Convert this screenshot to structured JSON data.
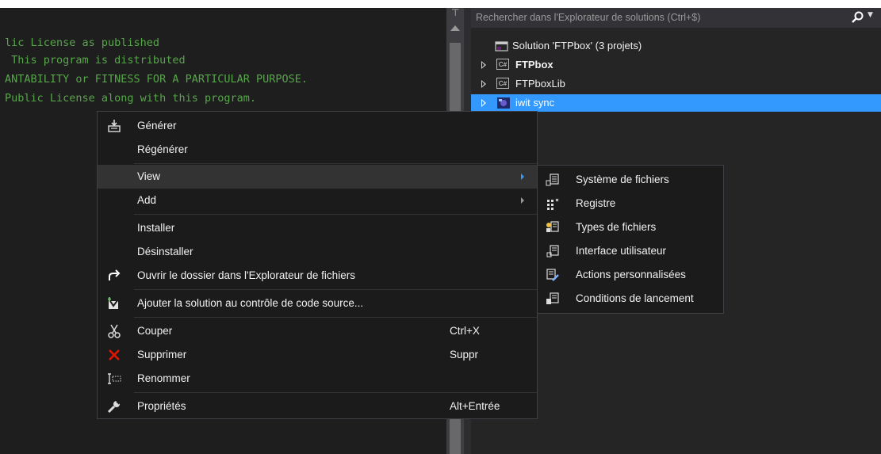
{
  "editor": {
    "lines": [
      "lic License as published",
      " This program is distributed",
      "ANTABILITY or FITNESS FOR A PARTICULAR PURPOSE.",
      "Public License along with this program."
    ]
  },
  "solution_explorer": {
    "search_placeholder": "Rechercher dans l'Explorateur de solutions (Ctrl+$)",
    "solution_label": "Solution 'FTPbox' (3 projets)",
    "projects": [
      {
        "label": "FTPbox",
        "icon": "csharp-project-icon",
        "bold": true
      },
      {
        "label": "FTPboxLib",
        "icon": "csharp-project-icon",
        "bold": false
      },
      {
        "label": "iwit sync",
        "icon": "setup-project-icon",
        "bold": false,
        "selected": true
      }
    ],
    "cs_badge": "C#"
  },
  "context_menu": {
    "items": [
      {
        "label": "Générer",
        "icon": "build-icon"
      },
      {
        "label": "Régénérer"
      },
      {
        "label": "View",
        "submenu": true,
        "hover": true
      },
      {
        "label": "Add",
        "submenu": true
      },
      {
        "label": "Installer"
      },
      {
        "label": "Désinstaller"
      },
      {
        "label": "Ouvrir le dossier dans l'Explorateur de fichiers",
        "icon": "open-folder-arrow-icon"
      },
      {
        "label": "Ajouter la solution au contrôle de code source...",
        "icon": "add-source-control-icon"
      },
      {
        "label": "Couper",
        "icon": "scissors-icon",
        "shortcut": "Ctrl+X"
      },
      {
        "label": "Supprimer",
        "icon": "delete-x-icon",
        "shortcut": "Suppr"
      },
      {
        "label": "Renommer",
        "icon": "rename-icon"
      },
      {
        "label": "Propriétés",
        "icon": "wrench-icon",
        "shortcut": "Alt+Entrée"
      }
    ]
  },
  "view_submenu": {
    "items": [
      {
        "label": "Système de fichiers",
        "icon": "file-system-icon"
      },
      {
        "label": "Registre",
        "icon": "registry-icon"
      },
      {
        "label": "Types de fichiers",
        "icon": "file-types-icon"
      },
      {
        "label": "Interface utilisateur",
        "icon": "user-interface-icon"
      },
      {
        "label": "Actions personnalisées",
        "icon": "custom-actions-icon"
      },
      {
        "label": "Conditions de lancement",
        "icon": "launch-conditions-icon"
      }
    ]
  },
  "colors": {
    "editor_bg": "#1e1e1e",
    "comment_green": "#57a64a",
    "selection_blue": "#3399ff",
    "menu_bg": "#1b1b1c",
    "delete_red": "#e51400"
  }
}
